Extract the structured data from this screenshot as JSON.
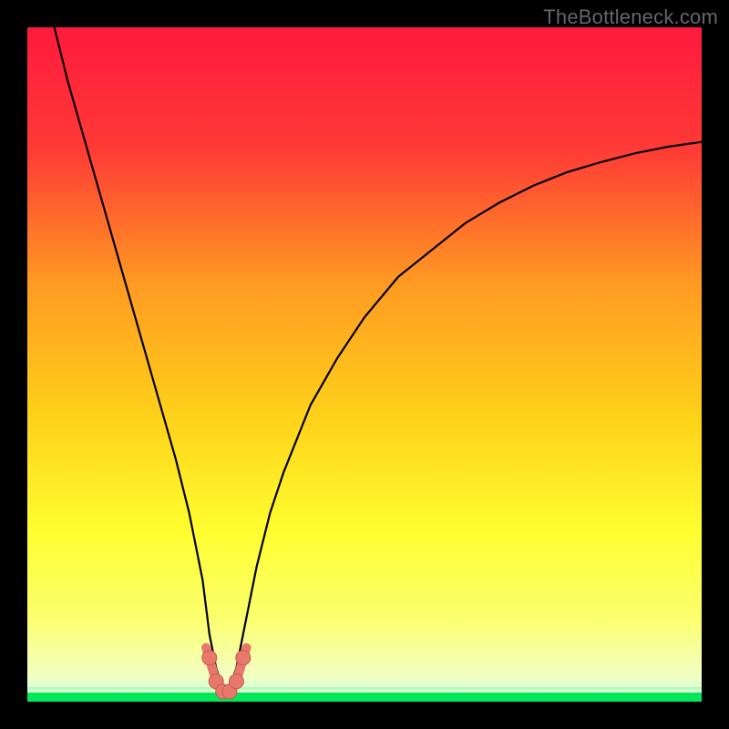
{
  "watermark": "TheBottleneck.com",
  "colors": {
    "background": "#000000",
    "gradient_top": "#ff1a3d",
    "gradient_mid1": "#ff4a33",
    "gradient_mid2": "#ff9a22",
    "gradient_mid3": "#ffd21a",
    "gradient_mid4": "#ffff30",
    "gradient_mid5": "#fbff70",
    "gradient_bottom_strip": "#00e85a",
    "curve": "#000000",
    "marker_fill": "#e8786b",
    "marker_stroke": "#c65a4f"
  },
  "chart_data": {
    "type": "line",
    "title": "",
    "xlabel": "",
    "ylabel": "",
    "xlim": [
      0,
      100
    ],
    "ylim": [
      0,
      100
    ],
    "series": [
      {
        "name": "bottleneck-curve",
        "x": [
          4,
          6,
          8,
          10,
          12,
          14,
          16,
          18,
          20,
          22,
          24,
          26,
          27,
          28,
          29,
          30,
          31,
          32,
          34,
          36,
          38,
          42,
          46,
          50,
          55,
          60,
          65,
          70,
          75,
          80,
          85,
          90,
          95,
          100
        ],
        "y": [
          100,
          92,
          85,
          78,
          71,
          64,
          57,
          50,
          43,
          36,
          28,
          18,
          10,
          5,
          2,
          2,
          5,
          10,
          20,
          28,
          34,
          44,
          51,
          57,
          63,
          67,
          71,
          74,
          76.5,
          78.5,
          80,
          81.3,
          82.3,
          83
        ]
      }
    ],
    "markers": {
      "name": "minimum-highlight",
      "x": [
        27,
        28,
        29,
        30,
        31,
        32
      ],
      "y": [
        6.5,
        3,
        1.5,
        1.5,
        3,
        6.5
      ]
    },
    "marker_stroke_curve": {
      "x": [
        26.5,
        28,
        29,
        30,
        31,
        32.5
      ],
      "y": [
        8,
        3,
        1.2,
        1.2,
        3,
        8
      ]
    }
  }
}
